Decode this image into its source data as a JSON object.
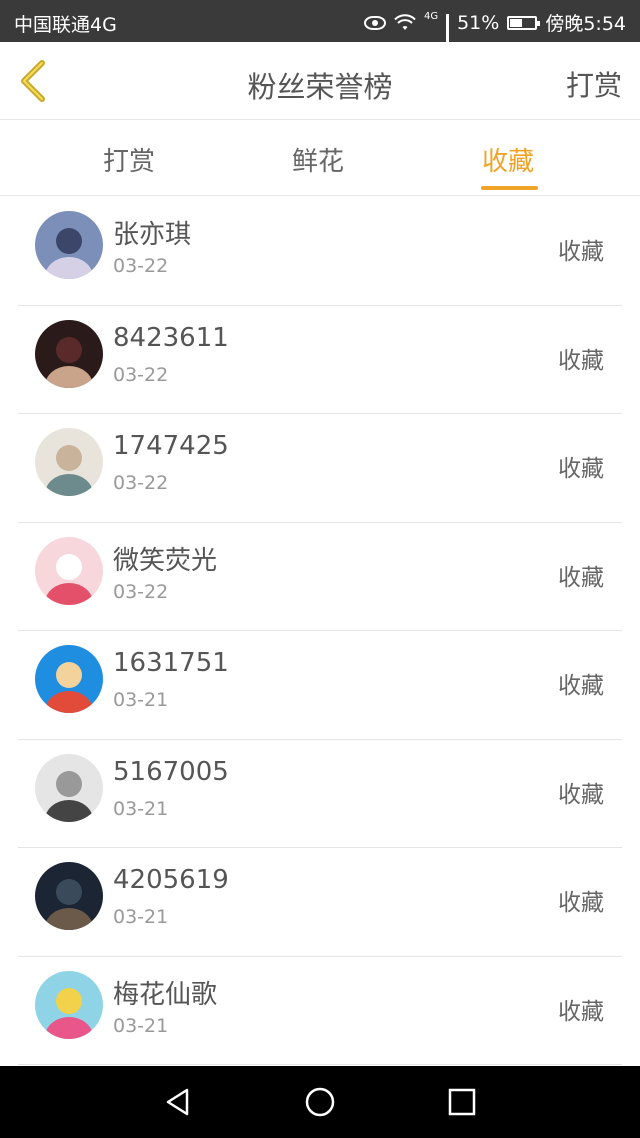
{
  "status_bar": {
    "carrier": "中国联通4G",
    "network_tag": "4G",
    "battery": "51%",
    "battery_level": 0.51,
    "time": "傍晚5:54"
  },
  "header": {
    "title": "粉丝荣誉榜",
    "action_label": "打赏"
  },
  "tabs": [
    {
      "label": "打赏",
      "active": false
    },
    {
      "label": "鲜花",
      "active": false
    },
    {
      "label": "收藏",
      "active": true
    }
  ],
  "accent_color": "#f0a327",
  "list": [
    {
      "name": "张亦琪",
      "date": "03-22",
      "action": "收藏",
      "avatar_colors": [
        "#7b8fb8",
        "#d6d0e6",
        "#3c4668"
      ]
    },
    {
      "name": "8423611",
      "date": "03-22",
      "action": "收藏",
      "avatar_colors": [
        "#2a1a1a",
        "#c9a38a",
        "#5a2a2a"
      ]
    },
    {
      "name": "1747425",
      "date": "03-22",
      "action": "收藏",
      "avatar_colors": [
        "#e8e4dc",
        "#6d8a8c",
        "#c9b39a"
      ]
    },
    {
      "name": "微笑荧光",
      "date": "03-22",
      "action": "收藏",
      "avatar_colors": [
        "#f7d7dc",
        "#e4506a",
        "#ffffff"
      ]
    },
    {
      "name": "1631751",
      "date": "03-21",
      "action": "收藏",
      "avatar_colors": [
        "#1f8ee0",
        "#e24a3a",
        "#f4d29c"
      ]
    },
    {
      "name": "5167005",
      "date": "03-21",
      "action": "收藏",
      "avatar_colors": [
        "#e5e5e5",
        "#444444",
        "#999999"
      ]
    },
    {
      "name": "4205619",
      "date": "03-21",
      "action": "收藏",
      "avatar_colors": [
        "#1b2533",
        "#6b5a4a",
        "#3a4a5a"
      ]
    },
    {
      "name": "梅花仙歌",
      "date": "03-21",
      "action": "收藏",
      "avatar_colors": [
        "#8fd4e6",
        "#e8568a",
        "#f2d24a"
      ]
    }
  ],
  "icons": {
    "back": "chevron-left-icon",
    "nav_back": "triangle-back-icon",
    "nav_home": "circle-home-icon",
    "nav_recent": "square-recent-icon"
  }
}
